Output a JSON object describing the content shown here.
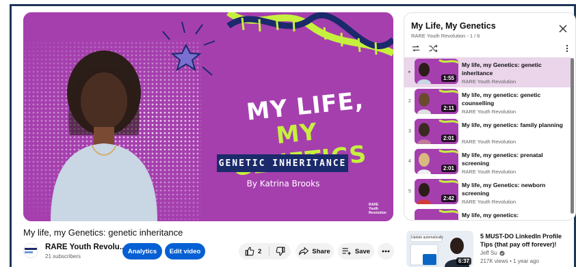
{
  "colors": {
    "thumb_purple": "#a53fae",
    "accent_green": "#c6f03e",
    "banner_navy": "#1b2a6b",
    "youtube_blue": "#065fd4",
    "active_row": "#ead5ea"
  },
  "player": {
    "thumbnail": {
      "line1": "MY LIFE,",
      "line2": "MY GENETICS",
      "banner": "GENETIC INHERITANCE",
      "author": "By Katrina Brooks",
      "logo_text": "RARE Youth Revolution"
    }
  },
  "video": {
    "title": "My life, my Genetics: genetic inheritance",
    "channel_name": "RARE Youth Revolu...",
    "subscribers": "21 subscribers",
    "analytics_label": "Analytics",
    "edit_label": "Edit video",
    "like_count": "2",
    "share_label": "Share",
    "save_label": "Save"
  },
  "playlist": {
    "title": "My Life, My Genetics",
    "subtitle": "RARE Youth Revolution - 1 / 6",
    "items": [
      {
        "index": "▸",
        "title": "My life, my Genetics: genetic inheritance",
        "channel": "RARE Youth Revolution",
        "duration": "1:55",
        "active": true
      },
      {
        "index": "2",
        "title": "My life, my genetics: genetic counselling",
        "channel": "RARE Youth Revolution",
        "duration": "2:11",
        "active": false
      },
      {
        "index": "3",
        "title": "My life, my genetics: family planning",
        "channel": "RARE Youth Revolution",
        "duration": "2:01",
        "active": false
      },
      {
        "index": "4",
        "title": "My life, my genetics: prenatal screening",
        "channel": "RARE Youth Revolution",
        "duration": "2:01",
        "active": false
      },
      {
        "index": "5",
        "title": "My life, my Genetics: newborn screening",
        "channel": "RARE Youth Revolution",
        "duration": "2:42",
        "active": false
      },
      {
        "index": "6",
        "title": "My life, my genetics:",
        "channel": "",
        "duration": "",
        "active": false
      }
    ]
  },
  "recommended": {
    "title": "5 MUST-DO LinkedIn Profile Tips (that pay off forever)!",
    "channel": "Jeff Su",
    "meta": "217K views • 1 year ago",
    "duration": "6:37",
    "thumb_caption": "Update automatically"
  }
}
